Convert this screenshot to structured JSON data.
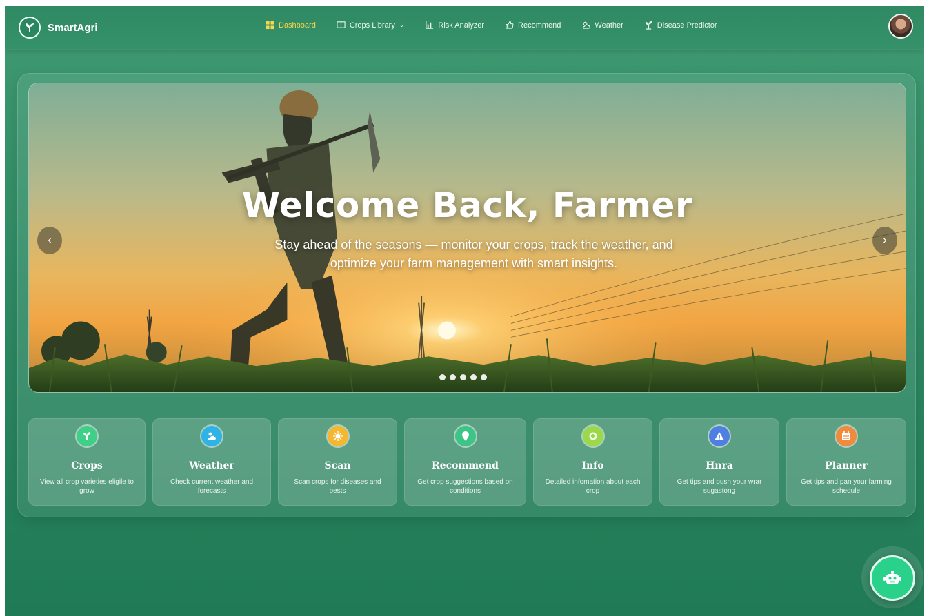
{
  "app": {
    "name": "SmartAgri"
  },
  "nav": {
    "items": [
      {
        "label": "Dashboard",
        "icon": "dashboard-icon",
        "active": true
      },
      {
        "label": "Crops Library",
        "icon": "book-icon",
        "dropdown": true
      },
      {
        "label": "Risk Analyzer",
        "icon": "chart-icon"
      },
      {
        "label": "Recommend",
        "icon": "thumbs-up-icon"
      },
      {
        "label": "Weather",
        "icon": "weather-icon"
      },
      {
        "label": "Disease Predictor",
        "icon": "plant-icon"
      }
    ]
  },
  "hero": {
    "title": "Welcome Back, Farmer",
    "subtitle": "Stay ahead of the seasons — monitor your crops, track the weather, and optimize your farm management with smart insights.",
    "prev_label": "‹",
    "next_label": "›",
    "slides": 5
  },
  "features": [
    {
      "title": "Crops",
      "desc": "View all crop varieties eligile to grow",
      "icon": "sprout-icon",
      "color": "#3fcf86"
    },
    {
      "title": "Weather",
      "desc": "Check current weather and forecasts",
      "icon": "cloud-sun-icon",
      "color": "#2fb3e6"
    },
    {
      "title": "Scan",
      "desc": "Scan crops for diseases and pests",
      "icon": "bug-icon",
      "color": "#f4b732"
    },
    {
      "title": "Recommend",
      "desc": "Get crop suggestions based on conditions",
      "icon": "location-pin-icon",
      "color": "#3ec486"
    },
    {
      "title": "Info",
      "desc": "Detailed infomation about each crop",
      "icon": "info-plus-icon",
      "color": "#9bd84a"
    },
    {
      "title": "Hnra",
      "desc": "Get tips and pusn your wrar sugastong",
      "icon": "warning-icon",
      "color": "#4f7fe0"
    },
    {
      "title": "Planner",
      "desc": "Get tips and pan your farming schedule",
      "icon": "calendar-icon",
      "color": "#f08a3c"
    }
  ],
  "colors": {
    "active_nav": "#f5d74a",
    "chat_button": "#2ad18b"
  }
}
